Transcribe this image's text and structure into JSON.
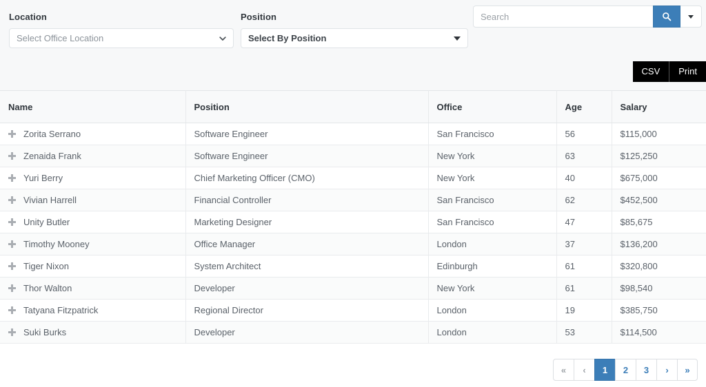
{
  "filters": {
    "location": {
      "label": "Location",
      "selected": "Select Office Location",
      "caret_icon": "chevron-down-icon"
    },
    "position": {
      "label": "Position",
      "selected": "Select By Position",
      "caret_icon": "caret-down-icon"
    }
  },
  "search": {
    "value": "",
    "placeholder": "Search",
    "button_icon": "search-icon",
    "dropdown_icon": "caret-down-icon"
  },
  "export": {
    "csv_label": "CSV",
    "print_label": "Print"
  },
  "table": {
    "columns": [
      "Name",
      "Position",
      "Office",
      "Age",
      "Salary"
    ],
    "row_expand_icon": "plus-icon",
    "rows": [
      {
        "name": "Zorita Serrano",
        "position": "Software Engineer",
        "office": "San Francisco",
        "age": "56",
        "salary": "$115,000"
      },
      {
        "name": "Zenaida Frank",
        "position": "Software Engineer",
        "office": "New York",
        "age": "63",
        "salary": "$125,250"
      },
      {
        "name": "Yuri Berry",
        "position": "Chief Marketing Officer (CMO)",
        "office": "New York",
        "age": "40",
        "salary": "$675,000"
      },
      {
        "name": "Vivian Harrell",
        "position": "Financial Controller",
        "office": "San Francisco",
        "age": "62",
        "salary": "$452,500"
      },
      {
        "name": "Unity Butler",
        "position": "Marketing Designer",
        "office": "San Francisco",
        "age": "47",
        "salary": "$85,675"
      },
      {
        "name": "Timothy Mooney",
        "position": "Office Manager",
        "office": "London",
        "age": "37",
        "salary": "$136,200"
      },
      {
        "name": "Tiger Nixon",
        "position": "System Architect",
        "office": "Edinburgh",
        "age": "61",
        "salary": "$320,800"
      },
      {
        "name": "Thor Walton",
        "position": "Developer",
        "office": "New York",
        "age": "61",
        "salary": "$98,540"
      },
      {
        "name": "Tatyana Fitzpatrick",
        "position": "Regional Director",
        "office": "London",
        "age": "19",
        "salary": "$385,750"
      },
      {
        "name": "Suki Burks",
        "position": "Developer",
        "office": "London",
        "age": "53",
        "salary": "$114,500"
      }
    ]
  },
  "pagination": {
    "items": [
      {
        "label": "«",
        "name": "pagination-first",
        "state": "disabled"
      },
      {
        "label": "‹",
        "name": "pagination-previous",
        "state": "disabled"
      },
      {
        "label": "1",
        "name": "pagination-page-1",
        "state": "active"
      },
      {
        "label": "2",
        "name": "pagination-page-2",
        "state": "normal"
      },
      {
        "label": "3",
        "name": "pagination-page-3",
        "state": "normal"
      },
      {
        "label": "›",
        "name": "pagination-next",
        "state": "normal"
      },
      {
        "label": "»",
        "name": "pagination-last",
        "state": "normal"
      }
    ]
  },
  "colors": {
    "accent_blue": "#3c7eb8",
    "export_black": "#000000",
    "header_bg": "#f8f9fa",
    "filter_bar_bg": "#f7f8f9"
  }
}
